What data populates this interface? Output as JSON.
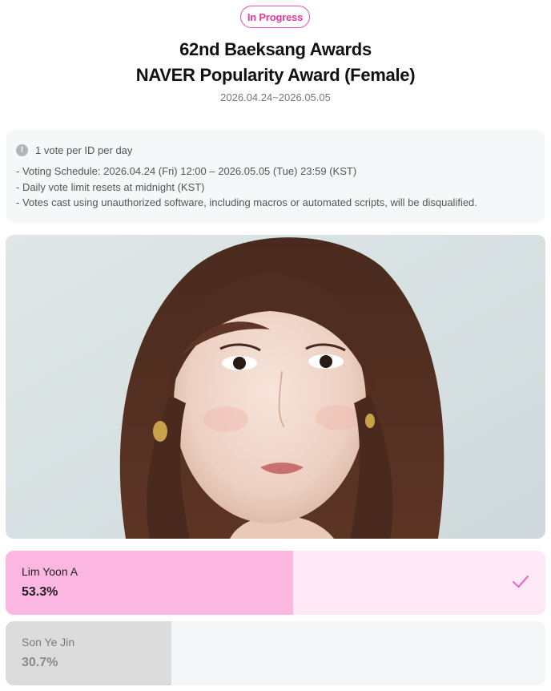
{
  "header": {
    "status": "In Progress",
    "title_line1": "62nd Baeksang Awards",
    "title_line2": "NAVER Popularity Award (Female)",
    "period": "2026.04.24~2026.05.05"
  },
  "notice": {
    "icon": "info-icon",
    "icon_glyph": "!",
    "headline": "1 vote per ID per day",
    "lines": [
      "- Voting Schedule: 2026.04.24 (Fri) 12:00 – 2026.05.05 (Tue) 23:59 (KST)",
      "- Daily vote limit resets at midnight (KST)",
      "- Votes cast using unauthorized software, including macros or automated scripts, will be disqualified."
    ]
  },
  "photo": {
    "subject": "candidate-portrait"
  },
  "candidates": [
    {
      "name": "Lim Yoon A",
      "percent_label": "53.3%",
      "percent": 53.3,
      "selected": true,
      "fill_color": "#fbb6e1",
      "track_color": "#ffe8f5",
      "icon": "check-icon"
    },
    {
      "name": "Son Ye Jin",
      "percent_label": "30.7%",
      "percent": 30.7,
      "selected": false,
      "fill_color": "#dcdcdd",
      "track_color": "#f5f6f7"
    }
  ],
  "colors": {
    "accent": "#ec4fb0",
    "check": "#e86cc4"
  }
}
